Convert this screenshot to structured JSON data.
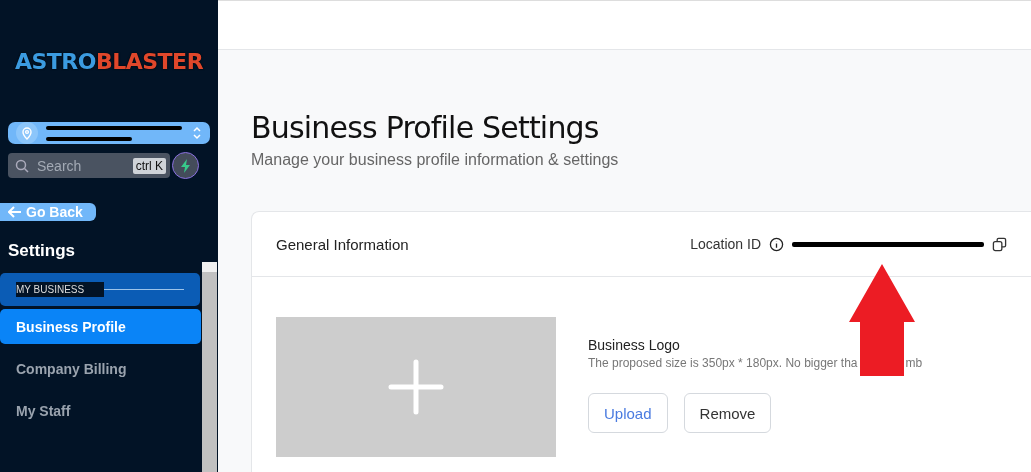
{
  "sidebar": {
    "logo": {
      "part_1": "ASTRO",
      "part_2": "BLASTER"
    },
    "search": {
      "placeholder": "Search",
      "shortcut": "ctrl K"
    },
    "back_button": "Go Back",
    "section_title": "Settings",
    "group_label": "MY BUSINESS",
    "items": [
      {
        "label": "Business Profile",
        "selected": true
      },
      {
        "label": "Company Billing",
        "selected": false
      },
      {
        "label": "My Staff",
        "selected": false
      }
    ]
  },
  "page": {
    "title": "Business Profile Settings",
    "subtitle": "Manage your business profile information & settings"
  },
  "card": {
    "title": "General Information",
    "location_label": "Location ID",
    "logo_title": "Business Logo",
    "logo_hint": "The proposed size is 350px * 180px. No bigger tha",
    "logo_hint_end": "mb",
    "buttons": [
      {
        "label": "Upload",
        "kind": "primary"
      },
      {
        "label": "Remove",
        "kind": "plain"
      }
    ]
  }
}
